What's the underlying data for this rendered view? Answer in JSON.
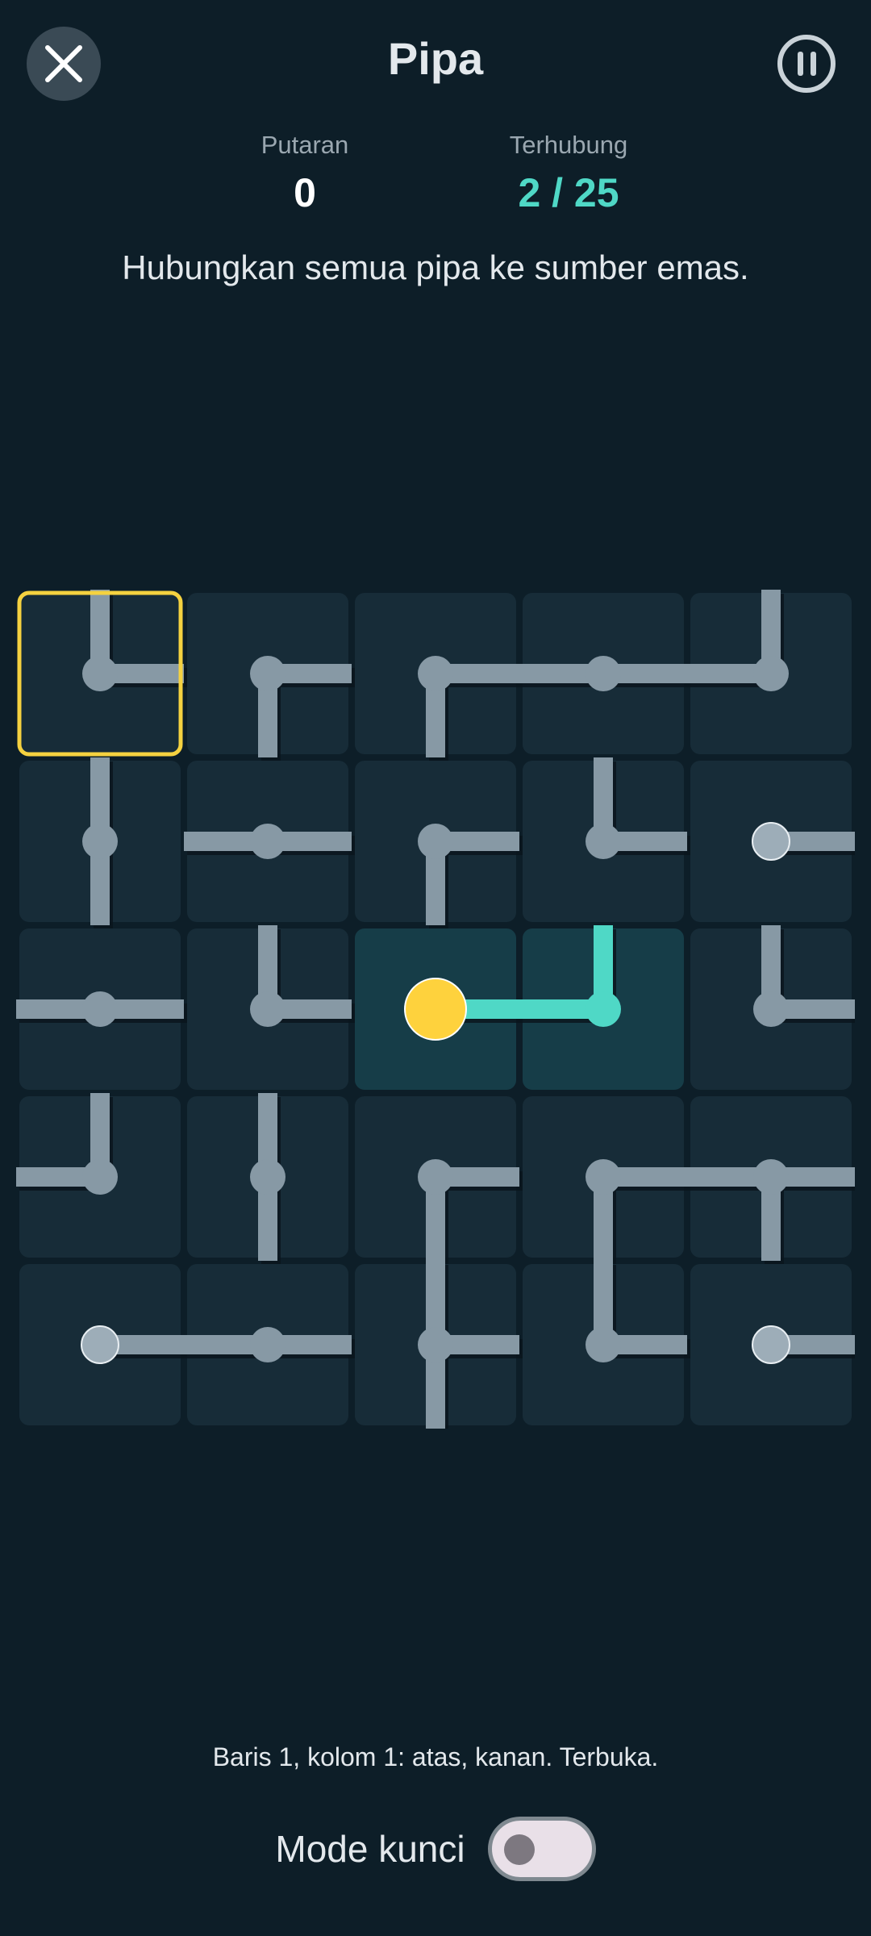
{
  "header": {
    "title": "Pipa",
    "close_icon": "close-icon",
    "pause_icon": "pause-icon"
  },
  "stats": {
    "moves_label": "Putaran",
    "moves_value": "0",
    "connected_label": "Terhubung",
    "connected_value": "2 / 25"
  },
  "instruction": "Hubungkan semua pipa ke sumber emas.",
  "board": {
    "rows": 5,
    "cols": 5,
    "selected": [
      0,
      0
    ],
    "source": [
      2,
      2
    ],
    "tiles": [
      [
        "NE",
        "ES",
        "ES",
        "EW",
        "NW"
      ],
      [
        "NS",
        "EW",
        "ES",
        "NE",
        "E"
      ],
      [
        "EW",
        "NE",
        "E",
        "NW",
        "NE"
      ],
      [
        "NW",
        "NS",
        "ES",
        "ES",
        "ESW"
      ],
      [
        "E",
        "EW",
        "NES",
        "NE",
        "E"
      ]
    ],
    "connected_cells": [
      [
        2,
        2
      ],
      [
        2,
        3
      ]
    ],
    "colors": {
      "tile": "#172c38",
      "tile_connected": "#163d48",
      "pipe": "#8799a5",
      "pipe_connected": "#4fd8c6",
      "source": "#fed23d",
      "selection": "#f5d240",
      "endpoint": "#9dadb8"
    }
  },
  "status": "Baris 1, kolom 1: atas, kanan. Terbuka.",
  "lock_mode": {
    "label": "Mode kunci",
    "enabled": false
  }
}
